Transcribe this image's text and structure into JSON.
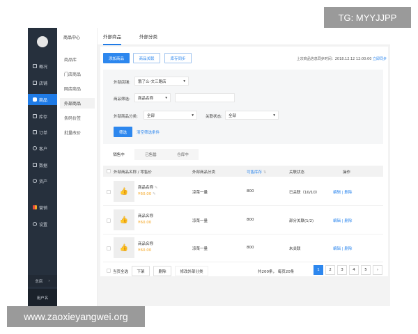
{
  "watermarks": {
    "top": "TG: MYYJJPP",
    "bottom": "www.zaoxieyangwei.org"
  },
  "sidebar": {
    "items": [
      {
        "label": "概况",
        "icon": "dashboard-icon"
      },
      {
        "label": "店铺",
        "icon": "store-icon"
      },
      {
        "label": "商品",
        "icon": "tag-icon",
        "active": true
      },
      {
        "label": "库存",
        "icon": "inventory-icon"
      },
      {
        "label": "订单",
        "icon": "order-icon"
      },
      {
        "label": "客户",
        "icon": "user-icon"
      },
      {
        "label": "数据",
        "icon": "chart-icon"
      },
      {
        "label": "资产",
        "icon": "asset-icon"
      },
      {
        "label": "营销",
        "icon": "marketing-icon"
      },
      {
        "label": "设置",
        "icon": "settings-icon"
      }
    ],
    "store": "总店",
    "store_arrow": "›",
    "username": "用户名"
  },
  "subnav": {
    "title": "商品中心",
    "items": [
      "商品库",
      "门店商品",
      "网店商品",
      "外部商品",
      "条码价签",
      "批量改价"
    ],
    "active": "外部商品"
  },
  "top_tabs": [
    "外部商品",
    "外部分类"
  ],
  "toolbar": {
    "add": "添加商品",
    "link": "商品关联",
    "sync": "库存同步",
    "sync_time_label": "上次商品信息同步时间：2018.12.12 12:00:00",
    "sync_now": "立即同步"
  },
  "filter": {
    "store_label": "外部店铺:",
    "store_value": "饿了么-文三路店",
    "goods_label": "商品筛选:",
    "goods_value": "商品名称",
    "goods_input": "",
    "category_label": "外部商品分类:",
    "category_value": "全部",
    "status_label": "关联状态:",
    "status_value": "全部",
    "submit": "筛选",
    "clear": "清空筛选条件"
  },
  "tabs": [
    "销售中",
    "已售罄",
    "仓库中"
  ],
  "table": {
    "headers": [
      "外部商品名称 / 零售价",
      "外部商品分类",
      "可售库存",
      "关联状态",
      "操作"
    ],
    "sort_icon": "⇅",
    "rows": [
      {
        "name": "商品名称",
        "price": "¥60.00",
        "category": "凉菜一量",
        "stock": "800",
        "status": "已关联（10/10）",
        "edit": "编辑",
        "del": "删除"
      },
      {
        "name": "商品名称",
        "price": "¥60.00",
        "category": "凉菜一量",
        "stock": "800",
        "status": "部分关联(1/2)",
        "edit": "编辑",
        "del": "删除"
      },
      {
        "name": "商品名称",
        "price": "¥60.00",
        "category": "凉菜一量",
        "stock": "800",
        "status": "未关联",
        "edit": "编辑",
        "del": "删除"
      }
    ]
  },
  "footer": {
    "select_all": "当页全选",
    "off_shelf": "下架",
    "delete": "删除",
    "change_category": "修改外部分类",
    "total": "共200条，",
    "per_page": "每页20条",
    "pages": [
      "1",
      "2",
      "3",
      "4",
      "5"
    ],
    "next": "›",
    "current_page": "1"
  }
}
